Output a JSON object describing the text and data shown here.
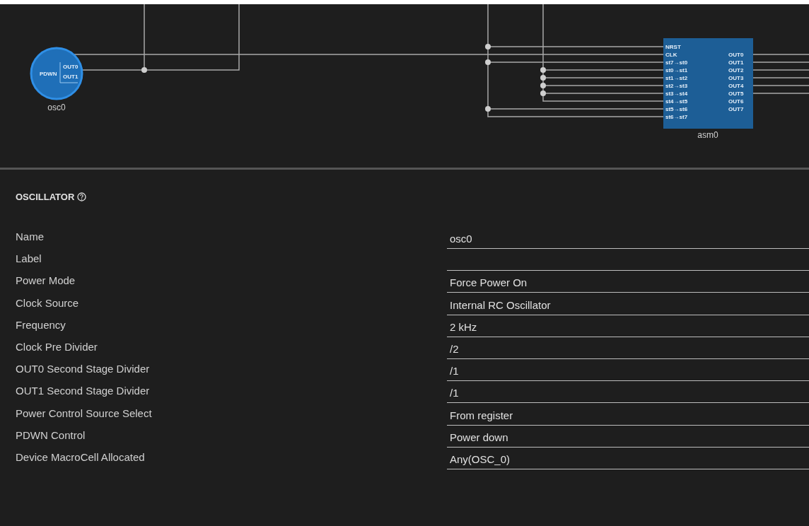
{
  "diagram": {
    "nodes": [
      {
        "kind": "oscillator",
        "label": "osc0",
        "inputs": [
          "PDWN"
        ],
        "outputs": [
          "OUT0",
          "OUT1"
        ]
      },
      {
        "kind": "block",
        "label": "asm0",
        "inputs": [
          "NRST",
          "CLK",
          "st7→st0",
          "st0→st1",
          "st1→st2",
          "st2→st3",
          "st3→st4",
          "st4→st5",
          "st5→st6",
          "st6→st7"
        ],
        "outputs": [
          "OUT0",
          "OUT1",
          "OUT2",
          "OUT3",
          "OUT4",
          "OUT5",
          "OUT6",
          "OUT7"
        ]
      }
    ]
  },
  "properties": {
    "title": "OSCILLATOR",
    "rows": [
      {
        "label": "Name",
        "value": "osc0"
      },
      {
        "label": "Label",
        "value": ""
      },
      {
        "label": "Power Mode",
        "value": "Force Power On"
      },
      {
        "label": "Clock Source",
        "value": "Internal RC Oscillator"
      },
      {
        "label": "Frequency",
        "value": "2 kHz"
      },
      {
        "label": "Clock Pre Divider",
        "value": "/2"
      },
      {
        "label": "OUT0 Second Stage Divider",
        "value": "/1"
      },
      {
        "label": "OUT1 Second Stage Divider",
        "value": "/1"
      },
      {
        "label": "Power Control Source Select",
        "value": "From register"
      },
      {
        "label": "PDWN Control",
        "value": "Power down"
      },
      {
        "label": "Device MacroCell Allocated",
        "value": "Any(OSC_0)"
      }
    ]
  }
}
